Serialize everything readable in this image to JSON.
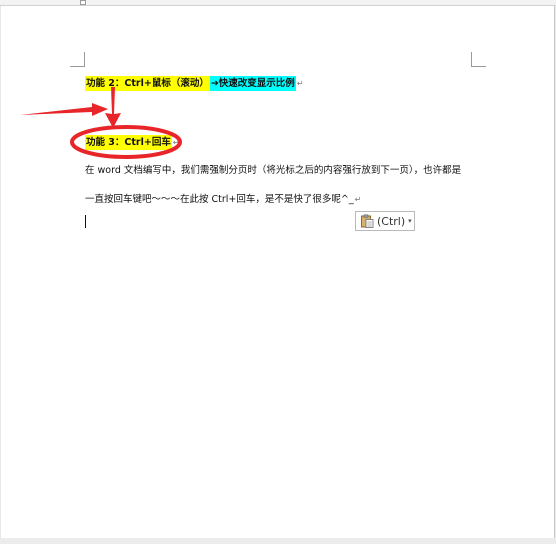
{
  "document": {
    "line1_segment1": "功能 2：Ctrl+鼠标（滚动）",
    "line1_segment2": "➔快速改变显示比例",
    "line2_heading": "功能 3：Ctrl+回车",
    "paragraph_line1": "在 word 文档编写中，我们需强制分页时（将光标之后的内容强行放到下一页），也许都是",
    "paragraph_line2": "一直按回车键吧～～～在此按 Ctrl+回车，是不是快了很多呢^_",
    "paragraph_mark": "↵"
  },
  "paste_options": {
    "label": "(Ctrl)",
    "icon": "clipboard-icon",
    "dropdown_icon": "▾"
  },
  "colors": {
    "highlight_yellow": "#ffff00",
    "highlight_cyan": "#00ffff",
    "annotation_red": "#e8262a"
  }
}
